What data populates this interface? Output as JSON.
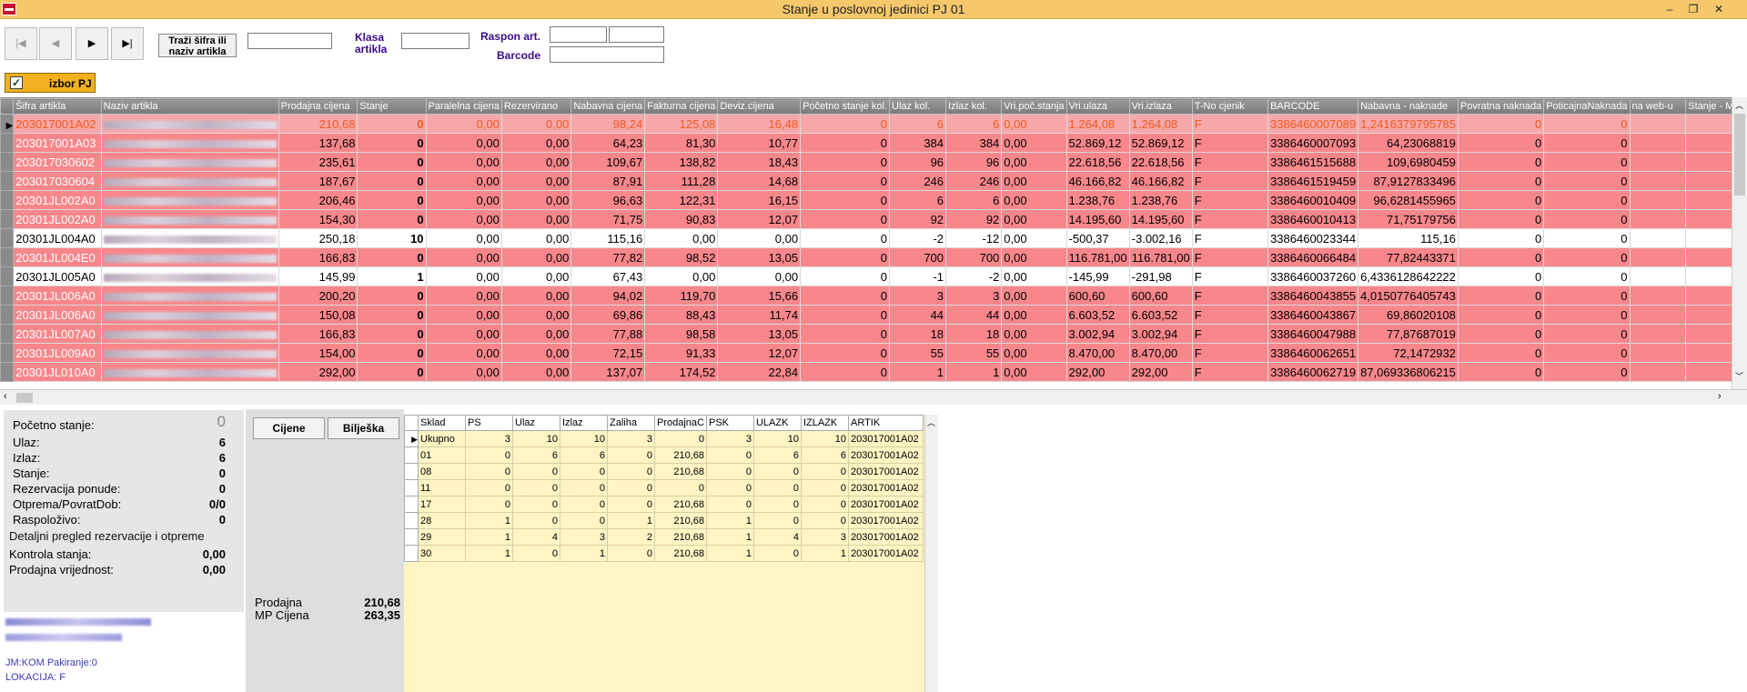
{
  "window": {
    "title": "Stanje u poslovnoj jedinici PJ 01",
    "controls": [
      "‒",
      "❐",
      "✕"
    ]
  },
  "toolbar": {
    "nav": [
      "|◀",
      "◀",
      "▶",
      "▶|"
    ],
    "search_button": "Traži šifra ili naziv artikla",
    "klasa_label": "Klasa artikla",
    "raspon_label": "Raspon art.",
    "barcode_label": "Barcode",
    "izbor_label": "izbor PJ"
  },
  "grid": {
    "columns": [
      "Šifra artikla",
      "Naziv artikla",
      "Prodajna cijena",
      "Stanje",
      "Paralelna cijena",
      "Rezervirano",
      "Nabavna cijena",
      "Fakturna cijena",
      "Deviz.cijena",
      "Početno stanje kol.",
      "Ulaz kol.",
      "Izlaz kol.",
      "Vri.poč.stanja",
      "Vri.ulaza",
      "Vri.izlaza",
      "T-No cjenik",
      "BARCODE",
      "Nabavna - naknade",
      "Povratna naknada",
      "PoticajnaNaknada",
      "na web-u",
      "Stanje - Min."
    ],
    "rows": [
      {
        "style": "sel",
        "cells": [
          "203017001A02",
          "",
          "210,68",
          "0",
          "0,00",
          "0,00",
          "98,24",
          "125,08",
          "16,48",
          "0",
          "6",
          "6",
          "0,00",
          "1.264,08",
          "1.264,08",
          "F",
          "3386460007089",
          "1,2416379795785",
          "0",
          "0",
          "",
          ""
        ]
      },
      {
        "style": "red",
        "cells": [
          "203017001A03",
          "",
          "137,68",
          "0",
          "0,00",
          "0,00",
          "64,23",
          "81,30",
          "10,77",
          "0",
          "384",
          "384",
          "0,00",
          "52.869,12",
          "52.869,12",
          "F",
          "3386460007093",
          "64,23068819",
          "0",
          "0",
          "",
          ""
        ]
      },
      {
        "style": "red",
        "cells": [
          "203017030602",
          "",
          "235,61",
          "0",
          "0,00",
          "0,00",
          "109,67",
          "138,82",
          "18,43",
          "0",
          "96",
          "96",
          "0,00",
          "22.618,56",
          "22.618,56",
          "F",
          "3386461515688",
          "109,6980459",
          "0",
          "0",
          "",
          ""
        ]
      },
      {
        "style": "red",
        "cells": [
          "203017030604",
          "",
          "187,67",
          "0",
          "0,00",
          "0,00",
          "87,91",
          "111,28",
          "14,68",
          "0",
          "246",
          "246",
          "0,00",
          "46.166,82",
          "46.166,82",
          "F",
          "3386461519459",
          "87,9127833496",
          "0",
          "0",
          "",
          ""
        ]
      },
      {
        "style": "red",
        "cells": [
          "20301JL002A0",
          "",
          "206,46",
          "0",
          "0,00",
          "0,00",
          "96,63",
          "122,31",
          "16,15",
          "0",
          "6",
          "6",
          "0,00",
          "1.238,76",
          "1.238,76",
          "F",
          "3386460010409",
          "96,6281455965",
          "0",
          "0",
          "",
          ""
        ]
      },
      {
        "style": "red",
        "cells": [
          "20301JL002A0",
          "",
          "154,30",
          "0",
          "0,00",
          "0,00",
          "71,75",
          "90,83",
          "12,07",
          "0",
          "92",
          "92",
          "0,00",
          "14.195,60",
          "14.195,60",
          "F",
          "3386460010413",
          "71,75179756",
          "0",
          "0",
          "",
          ""
        ]
      },
      {
        "style": "white",
        "cells": [
          "20301JL004A0",
          "",
          "250,18",
          "10",
          "0,00",
          "0,00",
          "115,16",
          "0,00",
          "0,00",
          "0",
          "-2",
          "-12",
          "0,00",
          "-500,37",
          "-3.002,16",
          "F",
          "3386460023344",
          "115,16",
          "0",
          "0",
          "",
          ""
        ]
      },
      {
        "style": "red",
        "cells": [
          "20301JL004E0",
          "",
          "166,83",
          "0",
          "0,00",
          "0,00",
          "77,82",
          "98,52",
          "13,05",
          "0",
          "700",
          "700",
          "0,00",
          "116.781,00",
          "116.781,00",
          "F",
          "3386460066484",
          "77,82443371",
          "0",
          "0",
          "",
          ""
        ]
      },
      {
        "style": "white",
        "cells": [
          "20301JL005A0",
          "",
          "145,99",
          "1",
          "0,00",
          "0,00",
          "67,43",
          "0,00",
          "0,00",
          "0",
          "-1",
          "-2",
          "0,00",
          "-145,99",
          "-291,98",
          "F",
          "3386460037260",
          "6,4336128642222",
          "0",
          "0",
          "",
          ""
        ]
      },
      {
        "style": "red",
        "cells": [
          "20301JL006A0",
          "",
          "200,20",
          "0",
          "0,00",
          "0,00",
          "94,02",
          "119,70",
          "15,66",
          "0",
          "3",
          "3",
          "0,00",
          "600,60",
          "600,60",
          "F",
          "3386460043855",
          "4,0150776405743",
          "0",
          "0",
          "",
          ""
        ]
      },
      {
        "style": "red",
        "cells": [
          "20301JL006A0",
          "",
          "150,08",
          "0",
          "0,00",
          "0,00",
          "69,86",
          "88,43",
          "11,74",
          "0",
          "44",
          "44",
          "0,00",
          "6.603,52",
          "6.603,52",
          "F",
          "3386460043867",
          "69,86020108",
          "0",
          "0",
          "",
          ""
        ]
      },
      {
        "style": "red",
        "cells": [
          "20301JL007A0",
          "",
          "166,83",
          "0",
          "0,00",
          "0,00",
          "77,88",
          "98,58",
          "13,05",
          "0",
          "18",
          "18",
          "0,00",
          "3.002,94",
          "3.002,94",
          "F",
          "3386460047988",
          "77,87687019",
          "0",
          "0",
          "",
          ""
        ]
      },
      {
        "style": "red",
        "cells": [
          "20301JL009A0",
          "",
          "154,00",
          "0",
          "0,00",
          "0,00",
          "72,15",
          "91,33",
          "12,07",
          "0",
          "55",
          "55",
          "0,00",
          "8.470,00",
          "8.470,00",
          "F",
          "3386460062651",
          "72,1472932",
          "0",
          "0",
          "",
          ""
        ]
      },
      {
        "style": "red",
        "cells": [
          "20301JL010A0",
          "",
          "292,00",
          "0",
          "0,00",
          "0,00",
          "137,07",
          "174,52",
          "22,84",
          "0",
          "1",
          "1",
          "0,00",
          "292,00",
          "292,00",
          "F",
          "3386460062719",
          "87,069336806215",
          "0",
          "0",
          "",
          ""
        ]
      }
    ]
  },
  "summary": {
    "pocetno_label": "Početno stanje:",
    "pocetno_value": "0",
    "ulaz_label": "Ulaz:",
    "ulaz_value": "6",
    "izlaz_label": "Izlaz:",
    "izlaz_value": "6",
    "stanje_label": "Stanje:",
    "stanje_value": "0",
    "rez_label": "Rezervacija ponude:",
    "rez_value": "0",
    "otp_label": "Otprema/PovratDob:",
    "otp_value": "0/0",
    "rasp_label": "Raspoloživo:",
    "rasp_value": "0",
    "detail_link": "Detaljni pregled rezervacije i otpreme",
    "kontrola_label": "Kontrola stanja:",
    "kontrola_value": "0,00",
    "prodvr_label": "Prodajna vrijednost:",
    "prodvr_value": "0,00",
    "jm_text": "JM:KOM Pakiranje:0",
    "lokacija_text": "LOKACIJA:  F"
  },
  "tabs": [
    "Cijene",
    "Bilješka"
  ],
  "prices": {
    "prodajna_label": "Prodajna",
    "prodajna_value": "210,68",
    "mp_label": "MP Cijena",
    "mp_value": "263,35"
  },
  "subgrid": {
    "columns": [
      "Sklad",
      "PS",
      "Ulaz",
      "Izlaz",
      "Zaliha",
      "ProdajnaC",
      "PSK",
      "ULAZK",
      "IZLAZK",
      "ARTIK"
    ],
    "rows": [
      [
        "Ukupno",
        "3",
        "10",
        "10",
        "3",
        "0",
        "3",
        "10",
        "10",
        "203017001A02"
      ],
      [
        "01",
        "0",
        "6",
        "6",
        "0",
        "210,68",
        "0",
        "6",
        "6",
        "203017001A02"
      ],
      [
        "08",
        "0",
        "0",
        "0",
        "0",
        "210,68",
        "0",
        "0",
        "0",
        "203017001A02"
      ],
      [
        "11",
        "0",
        "0",
        "0",
        "0",
        "0",
        "0",
        "0",
        "0",
        "203017001A02"
      ],
      [
        "17",
        "0",
        "0",
        "0",
        "0",
        "210,68",
        "0",
        "0",
        "0",
        "203017001A02"
      ],
      [
        "28",
        "1",
        "0",
        "0",
        "1",
        "210,68",
        "1",
        "0",
        "0",
        "203017001A02"
      ],
      [
        "29",
        "1",
        "4",
        "3",
        "2",
        "210,68",
        "1",
        "4",
        "3",
        "203017001A02"
      ],
      [
        "30",
        "1",
        "0",
        "1",
        "0",
        "210,68",
        "1",
        "0",
        "1",
        "203017001A02"
      ]
    ]
  }
}
